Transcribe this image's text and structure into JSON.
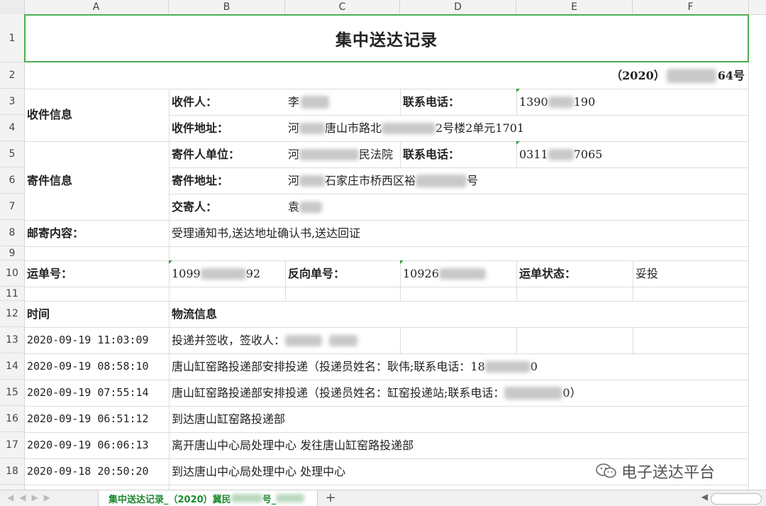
{
  "columns": [
    "A",
    "B",
    "C",
    "D",
    "E",
    "F"
  ],
  "rows": [
    "1",
    "2",
    "3",
    "4",
    "5",
    "6",
    "7",
    "8",
    "9",
    "10",
    "11",
    "12",
    "13",
    "14",
    "15",
    "16",
    "17",
    "18"
  ],
  "title": "集中送达记录",
  "case_number_prefix": "（2020）",
  "case_number_suffix": "64号",
  "recipient": {
    "section_label": "收件信息",
    "name_label": "收件人：",
    "name_value": "李",
    "phone_label": "联系电话：",
    "phone_prefix": "1390",
    "phone_suffix": "190",
    "address_label": "收件地址：",
    "address_part1": "河",
    "address_part2": "唐山市路北",
    "address_part3": "2号楼2单元1701"
  },
  "sender": {
    "section_label": "寄件信息",
    "unit_label": "寄件人单位：",
    "unit_part1": "河",
    "unit_part2": "民法院",
    "phone_label": "联系电话：",
    "phone_prefix": "0311",
    "phone_suffix": "7065",
    "address_label": "寄件地址：",
    "address_part1": "河",
    "address_part2": "石家庄市桥西区裕",
    "address_part3": "号",
    "mailer_label": "交寄人：",
    "mailer_value": "袁"
  },
  "contents_label": "邮寄内容：",
  "contents_value": "受理通知书,送达地址确认书,送达回证",
  "waybill": {
    "label": "运单号：",
    "prefix": "1099",
    "suffix": "92",
    "reverse_label": "反向单号：",
    "reverse_prefix": "10926",
    "status_label": "运单状态：",
    "status_value": "妥投"
  },
  "log_header": {
    "time": "时间",
    "info": "物流信息"
  },
  "logs": [
    {
      "time": "2020-09-19 11:03:09",
      "info": "投递并签收，签收人：",
      "tail": ""
    },
    {
      "time": "2020-09-19 08:58:10",
      "info": "唐山缸窑路投递部安排投递（投递员姓名：耿伟;联系电话：18",
      "tail": "0"
    },
    {
      "time": "2020-09-19 07:55:14",
      "info": "唐山缸窑路投递部安排投递（投递员姓名：缸窑投递站;联系电话：",
      "tail": "0）"
    },
    {
      "time": "2020-09-19 06:51:12",
      "info": "到达唐山缸窑路投递部",
      "tail": ""
    },
    {
      "time": "2020-09-19 06:06:13",
      "info": "离开唐山中心局处理中心 发往唐山缸窑路投递部",
      "tail": ""
    },
    {
      "time": "2020-09-18 20:50:20",
      "info": "到达唐山中心局处理中心 处理中心",
      "tail": ""
    }
  ],
  "sheet_tab_prefix": "集中送达记录_（2020）冀民",
  "sheet_tab_mid": "号_",
  "add_sheet_icon": "plus-icon",
  "watermark": "电子送达平台"
}
